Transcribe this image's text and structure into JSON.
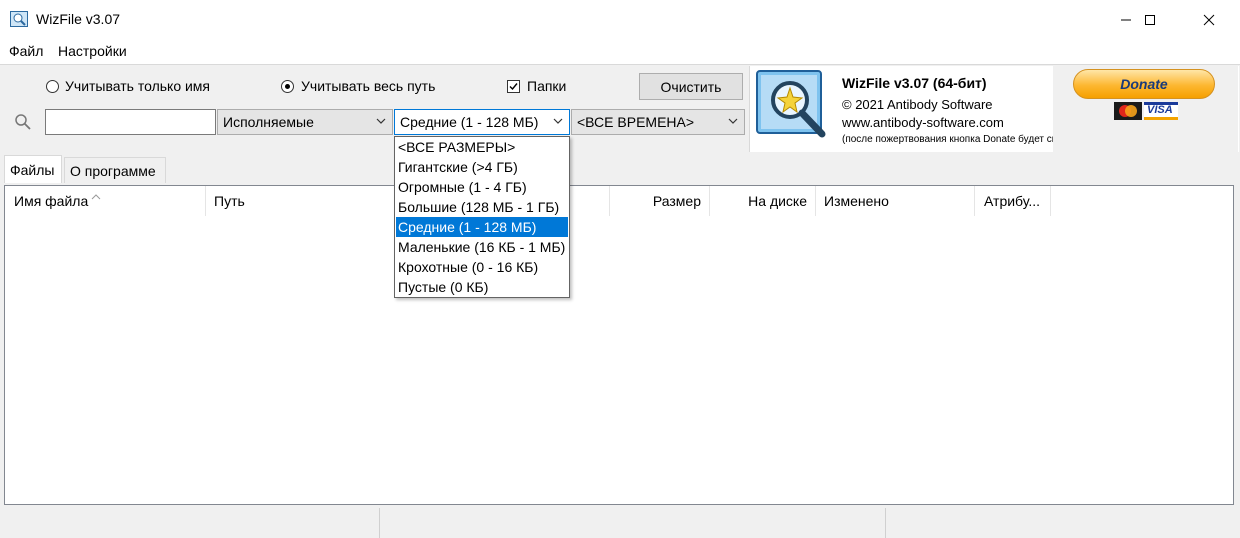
{
  "window": {
    "title": "WizFile v3.07",
    "controls": [
      "minimize-icon",
      "maximize-icon",
      "close-icon"
    ]
  },
  "menu": {
    "items": [
      "Файл",
      "Настройки"
    ]
  },
  "options": {
    "radio_name_only": "Учитывать только имя",
    "radio_full_path": "Учитывать весь путь",
    "radio_selected": "full_path",
    "checkbox_folders": "Папки",
    "checkbox_folders_checked": true,
    "clear_button": "Очистить"
  },
  "search": {
    "query": "",
    "type_filter": "Исполняемые",
    "size_filter": "Средние (1 - 128 МБ)",
    "time_filter": "<ВСЕ ВРЕМЕНА>"
  },
  "about": {
    "title": "WizFile v3.07 (64-бит)",
    "copyright": "© 2021 Antibody Software",
    "website": "www.antibody-software.com",
    "note": "(после пожертвования кнопка Donate будет скрыта)",
    "donate_label": "Donate",
    "card_brands": [
      "MasterCard",
      "VISA"
    ]
  },
  "tabs": [
    {
      "label": "Файлы",
      "active": true
    },
    {
      "label": "О программе",
      "active": false
    }
  ],
  "columns": [
    "Имя файла",
    "Путь",
    "Размер",
    "На диске",
    "Изменено",
    "Атрибу..."
  ],
  "size_dropdown": {
    "open": true,
    "options": [
      "<ВСЕ РАЗМЕРЫ>",
      "Гигантские (>4 ГБ)",
      "Огромные (1 - 4 ГБ)",
      "Большие (128 МБ - 1 ГБ)",
      "Средние (1 - 128 МБ)",
      "Маленькие (16 КБ - 1 МБ)",
      "Крохотные (0 - 16 КБ)",
      "Пустые (0 КБ)"
    ],
    "selected_index": 4
  },
  "colors": {
    "accent": "#0078d7",
    "donate": "#fdb731"
  }
}
